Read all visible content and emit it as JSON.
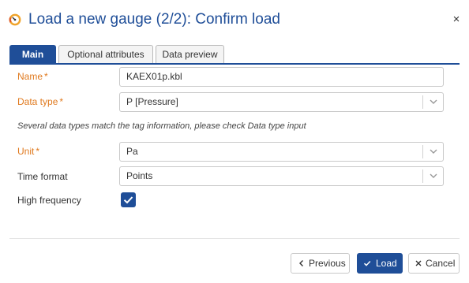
{
  "dialog": {
    "icon": "gauge-icon",
    "title": "Load a new gauge (2/2): Confirm load",
    "close_icon": "close-icon",
    "close_glyph": "×"
  },
  "tabs": [
    {
      "label": "Main",
      "active": true
    },
    {
      "label": "Optional attributes",
      "active": false
    },
    {
      "label": "Data preview",
      "active": false
    }
  ],
  "form": {
    "required_marker": "*",
    "name": {
      "label": "Name",
      "required": true,
      "value": "KAEX01p.kbl"
    },
    "data_type": {
      "label": "Data type",
      "required": true,
      "value": "P [Pressure]"
    },
    "info": "Several data types match the tag information, please check Data type input",
    "unit": {
      "label": "Unit",
      "required": true,
      "value": "Pa"
    },
    "time_format": {
      "label": "Time format",
      "required": false,
      "value": "Points"
    },
    "high_frequency": {
      "label": "High frequency",
      "checked": true
    }
  },
  "footer": {
    "previous": {
      "label": "Previous",
      "icon": "chevron-left-icon"
    },
    "load": {
      "label": "Load",
      "icon": "check-icon"
    },
    "cancel": {
      "label": "Cancel",
      "icon": "close-icon"
    }
  },
  "colors": {
    "accent": "#1f4e98",
    "required": "#e07a1f",
    "gauge_ring": "#f0a42b"
  }
}
